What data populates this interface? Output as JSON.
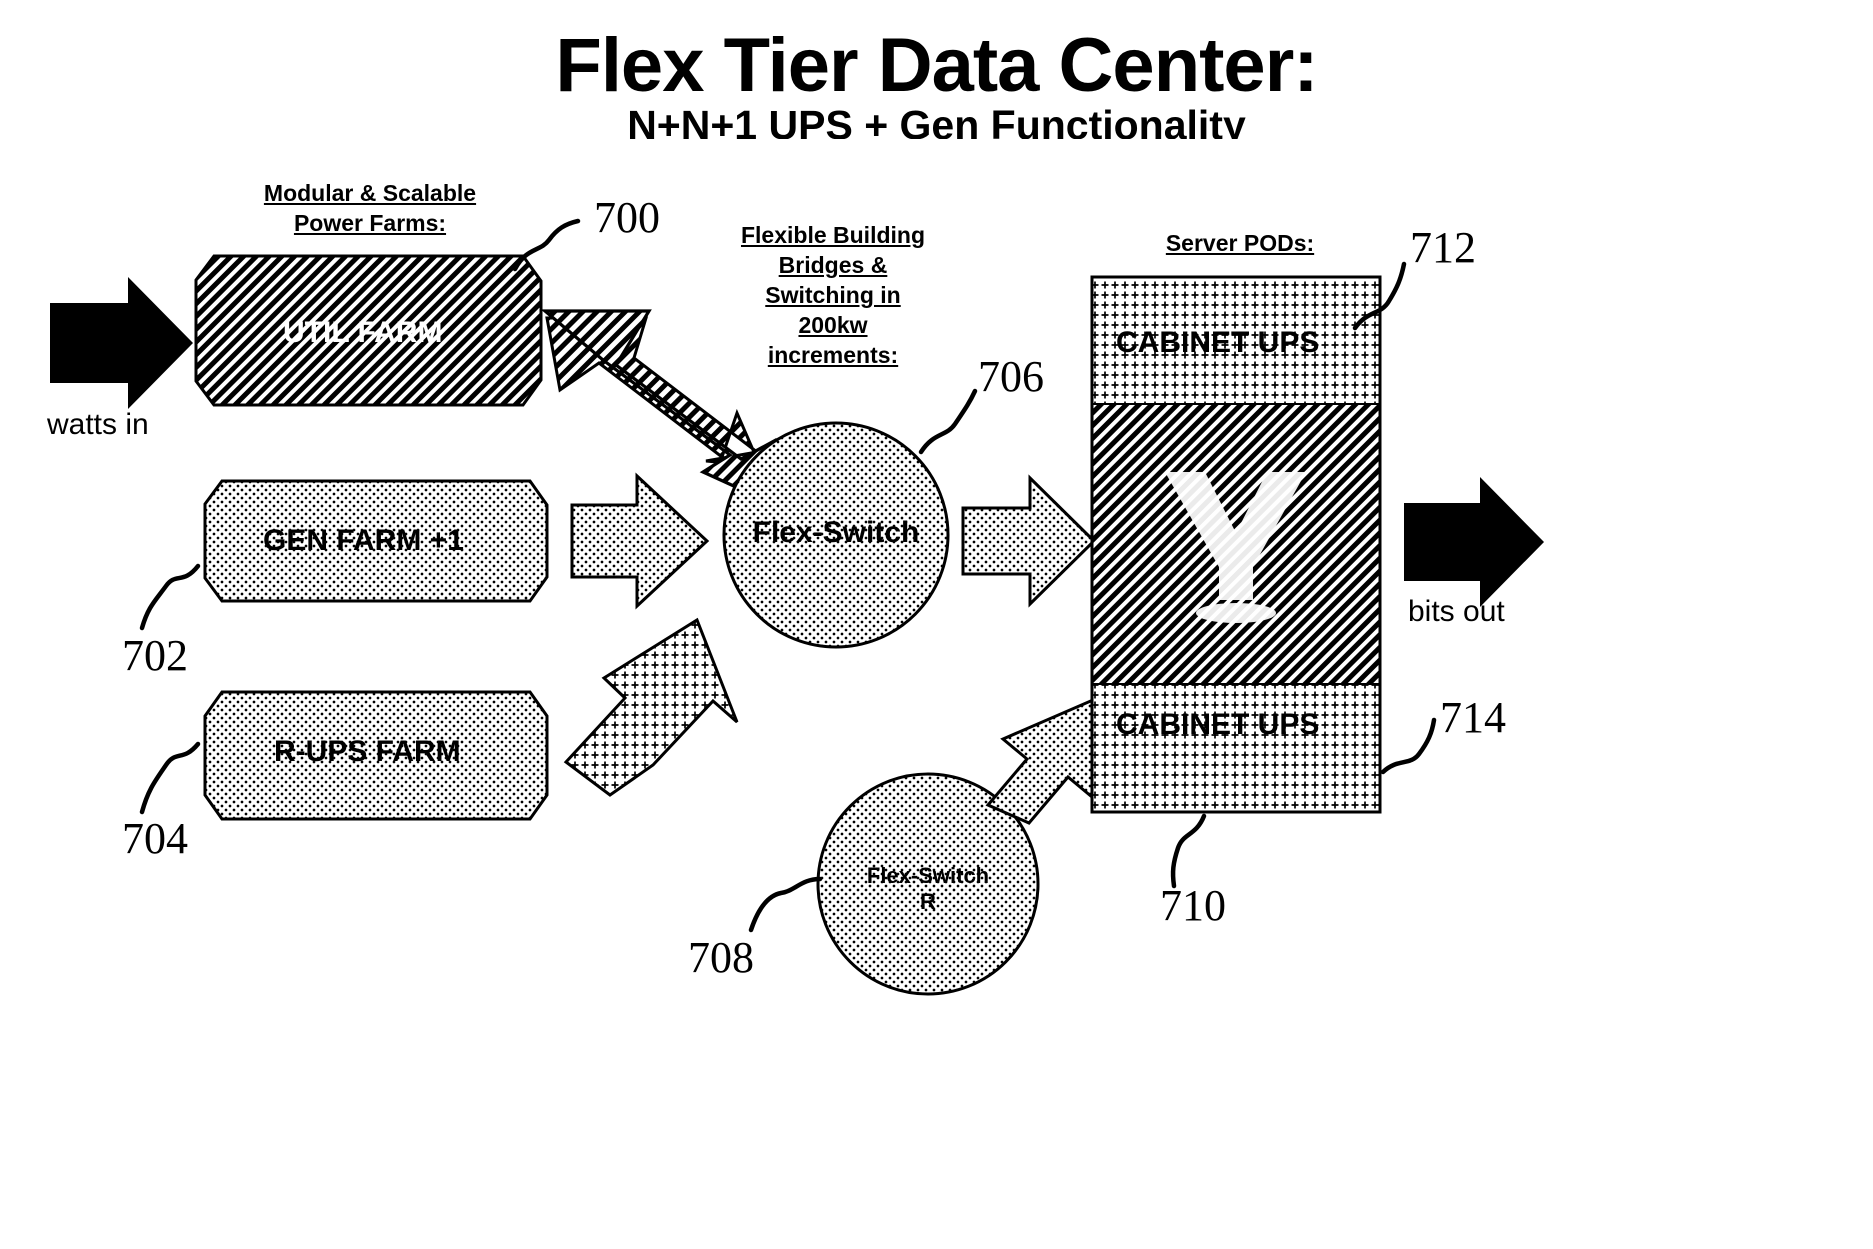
{
  "header": {
    "title": "Flex Tier Data Center:",
    "subtitle": "N+N+1 UPS + Gen Functionality"
  },
  "section_labels": {
    "power_farms": [
      "Modular & Scalable",
      "Power Farms:"
    ],
    "bridges": [
      "Flexible Building",
      "Bridges &",
      "Switching in",
      "200kw",
      "increments:"
    ],
    "server_pods": [
      "Server PODs:"
    ]
  },
  "blocks": {
    "util_farm": "UTIL FARM",
    "gen_farm": "GEN FARM +1",
    "rups_farm": "R-UPS FARM",
    "flex_switch": "Flex-Switch",
    "flex_switch_r": [
      "Flex-Switch",
      "R"
    ],
    "cabinet_ups_top": "CABINET UPS",
    "cabinet_ups_bottom": "CABINET UPS",
    "pod_logo": "Y"
  },
  "flow_labels": {
    "input": "watts in",
    "output": "bits out"
  },
  "reference_numerals": {
    "n700": "700",
    "n702": "702",
    "n704": "704",
    "n706": "706",
    "n708": "708",
    "n710": "710",
    "n712": "712",
    "n714": "714"
  },
  "colors": {
    "ink": "#000000",
    "paper": "#ffffff"
  }
}
